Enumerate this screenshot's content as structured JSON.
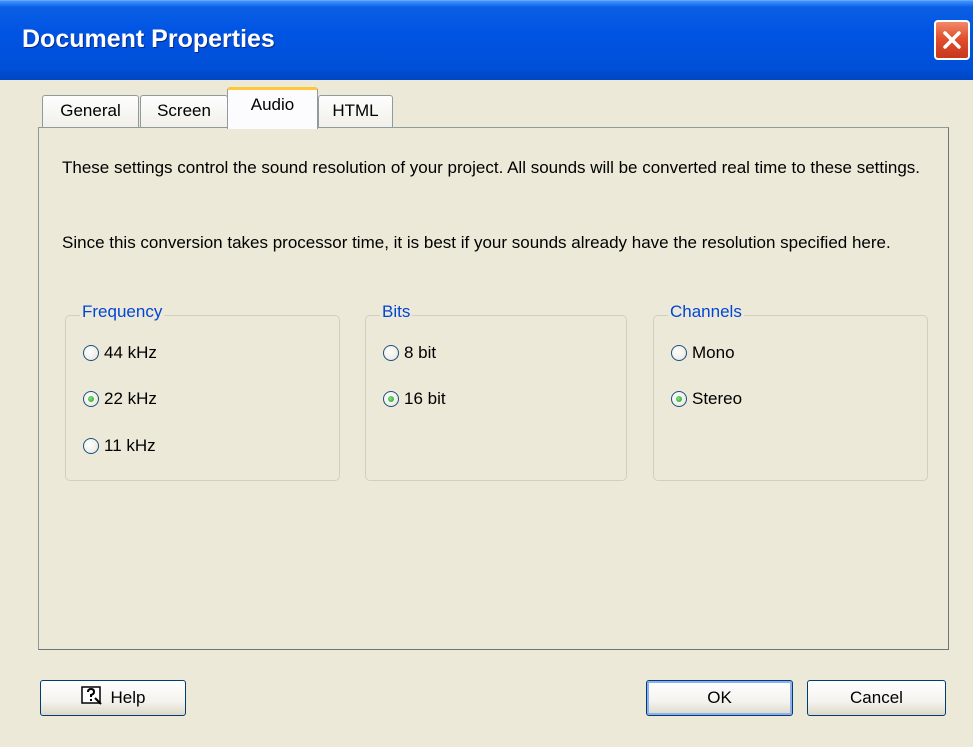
{
  "window": {
    "title": "Document Properties",
    "close_icon": "close-icon"
  },
  "tabs": [
    {
      "label": "General",
      "active": false
    },
    {
      "label": "Screen",
      "active": false
    },
    {
      "label": "Audio",
      "active": true
    },
    {
      "label": "HTML",
      "active": false
    }
  ],
  "audio": {
    "description1": "These settings control the sound resolution of your project. All sounds will be converted real time to these settings.",
    "description2": "Since this conversion takes processor time, it is best if your sounds already have the resolution specified here.",
    "frequency": {
      "label": "Frequency",
      "options": [
        {
          "label": "44 kHz",
          "selected": false
        },
        {
          "label": "22 kHz",
          "selected": true
        },
        {
          "label": "11 kHz",
          "selected": false
        }
      ]
    },
    "bits": {
      "label": "Bits",
      "options": [
        {
          "label": "8 bit",
          "selected": false
        },
        {
          "label": "16 bit",
          "selected": true
        }
      ]
    },
    "channels": {
      "label": "Channels",
      "options": [
        {
          "label": "Mono",
          "selected": false
        },
        {
          "label": "Stereo",
          "selected": true
        }
      ]
    }
  },
  "buttons": {
    "help": "Help",
    "ok": "OK",
    "cancel": "Cancel"
  },
  "colors": {
    "titlebar": "#0054e3",
    "group_label": "#0046d5",
    "tab_highlight": "#ffc83c",
    "face": "#ece9d8"
  }
}
